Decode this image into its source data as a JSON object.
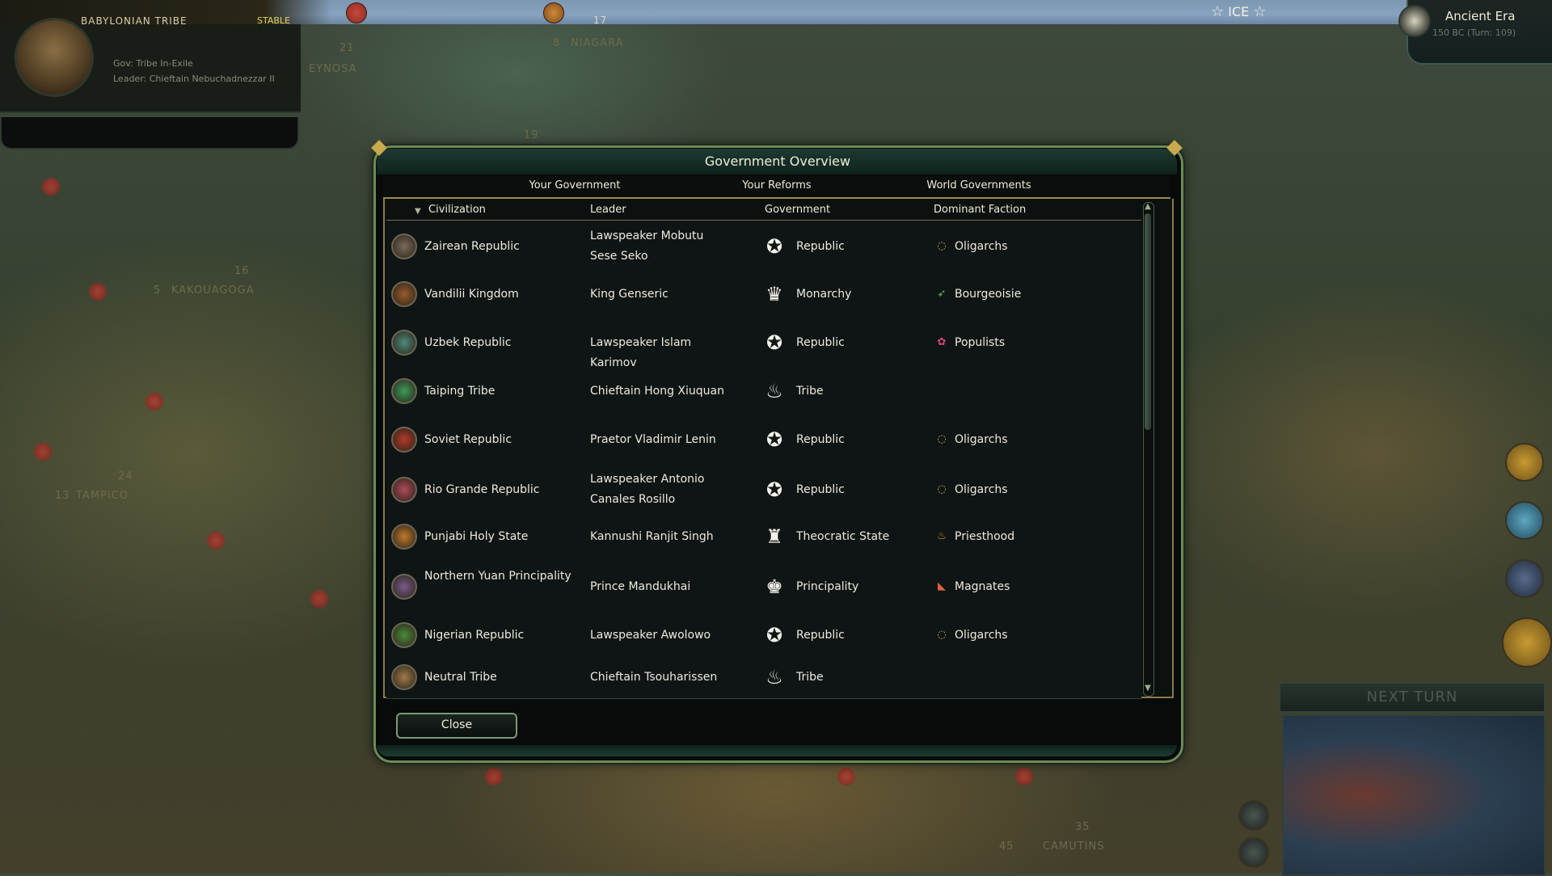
{
  "hud": {
    "civ_name": "BABYLONIAN TRIBE",
    "stability": "STABLE",
    "gov_line": "Gov: Tribe In-Exile",
    "leader_line": "Leader: Chieftain Nebuchadnezzar II",
    "ice": "ICE",
    "era": "Ancient Era",
    "turn": "150 BC (Turn: 109)",
    "next_turn": "NEXT TURN",
    "map_labels": [
      "EYNOSA",
      "NIAGARA",
      "KAKOUAGOGA",
      "TAMPICO",
      "CAMUTINS"
    ],
    "map_numbers": [
      "8",
      "17",
      "21",
      "16",
      "5",
      "19",
      "24",
      "13",
      "45",
      "35"
    ]
  },
  "dialog": {
    "title": "Government Overview",
    "tabs": [
      "Your Government",
      "Your Reforms",
      "World Governments"
    ],
    "columns": {
      "civilization": "Civilization",
      "leader": "Leader",
      "government": "Government",
      "faction": "Dominant Faction"
    },
    "rows": [
      {
        "civ": "Zairean Republic",
        "leader": "Lawspeaker Mobutu Sese Seko",
        "government": "Republic",
        "faction": "Oligarchs",
        "civ_color": "#7a6a5a"
      },
      {
        "civ": "Vandilii Kingdom",
        "leader": "King Genseric",
        "government": "Monarchy",
        "faction": "Bourgeoisie",
        "civ_color": "#9a5a2e"
      },
      {
        "civ": "Uzbek Republic",
        "leader": "Lawspeaker Islam Karimov",
        "government": "Republic",
        "faction": "Populists",
        "civ_color": "#4d8a7a"
      },
      {
        "civ": "Taiping Tribe",
        "leader": "Chieftain Hong Xiuquan",
        "government": "Tribe",
        "faction": "",
        "civ_color": "#3e9a5a"
      },
      {
        "civ": "Soviet Republic",
        "leader": "Praetor Vladimir Lenin",
        "government": "Republic",
        "faction": "Oligarchs",
        "civ_color": "#b33a2a"
      },
      {
        "civ": "Rio Grande Republic",
        "leader": "Lawspeaker Antonio Canales Rosillo",
        "government": "Republic",
        "faction": "Oligarchs",
        "civ_color": "#b04a5a"
      },
      {
        "civ": "Punjabi Holy State",
        "leader": "Kannushi Ranjit Singh",
        "government": "Theocratic State",
        "faction": "Priesthood",
        "civ_color": "#c0782a"
      },
      {
        "civ": "Northern Yuan Principality",
        "leader": "Prince Mandukhai",
        "government": "Principality",
        "faction": "Magnates",
        "civ_color": "#7a5a8a"
      },
      {
        "civ": "Nigerian Republic",
        "leader": "Lawspeaker Awolowo",
        "government": "Republic",
        "faction": "Oligarchs",
        "civ_color": "#4a8a3a"
      },
      {
        "civ": "Neutral Tribe",
        "leader": "Chieftain Tsouharissen",
        "government": "Tribe",
        "faction": "",
        "civ_color": "#a07a4a"
      }
    ],
    "close_label": "Close"
  },
  "icons": {
    "Republic": "laurel-wreath-icon",
    "Monarchy": "crown-icon",
    "Tribe": "campfire-icon",
    "Theocratic State": "mitre-icon",
    "Principality": "coronet-icon",
    "Oligarchs": "ring-icon",
    "Bourgeoisie": "wing-icon",
    "Populists": "flower-icon",
    "Priesthood": "flame-icon",
    "Magnates": "boot-icon"
  }
}
